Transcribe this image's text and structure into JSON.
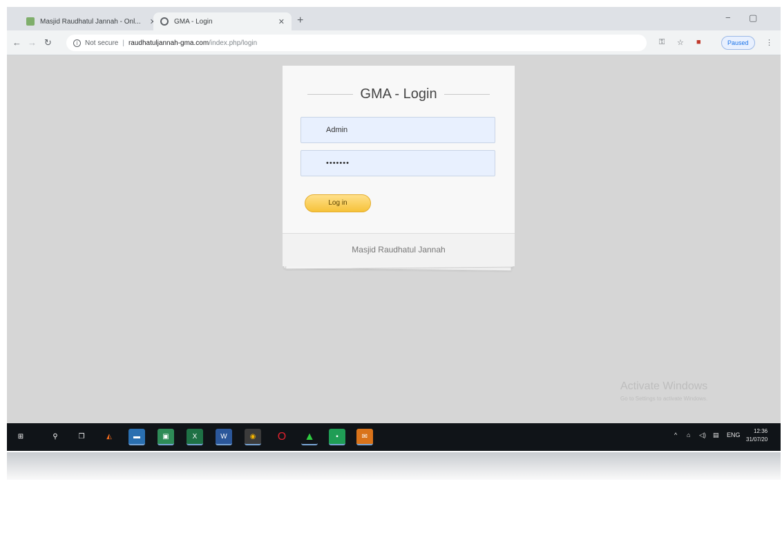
{
  "browser": {
    "tabs": [
      {
        "title": "Masjid Raudhatul Jannah - Onl...",
        "favicon": "mosque-icon",
        "active": false
      },
      {
        "title": "GMA - Login",
        "favicon": "globe-icon",
        "active": true
      }
    ],
    "new_tab": "+",
    "window_controls": {
      "minimize": "−",
      "maximize": "▢"
    },
    "address": {
      "security": "Not secure",
      "host": "raudhatuljannah-gma.com",
      "path": "/index.php/login"
    },
    "toolbar_icons": [
      "key-icon",
      "star-icon",
      "extension-icon"
    ],
    "profile_chip": "Paused"
  },
  "login": {
    "title": "GMA - Login",
    "username_value": "Admin",
    "password_value": "•••••••",
    "button_label": "Log in",
    "footer": "Masjid Raudhatul Jannah"
  },
  "watermark": {
    "title": "Activate Windows",
    "subtitle": "Go to Settings to activate Windows."
  },
  "taskbar": {
    "apps": [
      "start-icon",
      "search-icon",
      "task-view-icon",
      "matlab-icon",
      "file-explorer-icon",
      "store-icon",
      "excel-icon",
      "word-icon",
      "chrome-icon",
      "opera-icon",
      "app-green-icon",
      "app-square-icon",
      "mail-icon"
    ],
    "tray": {
      "language": "ENG",
      "time": "12:36",
      "date": "31/07/20"
    }
  },
  "colors": {
    "page_bg": "#d6d6d6",
    "field_bg": "#e8f0fe",
    "button": "#f6c23a",
    "taskbar": "#101418"
  }
}
